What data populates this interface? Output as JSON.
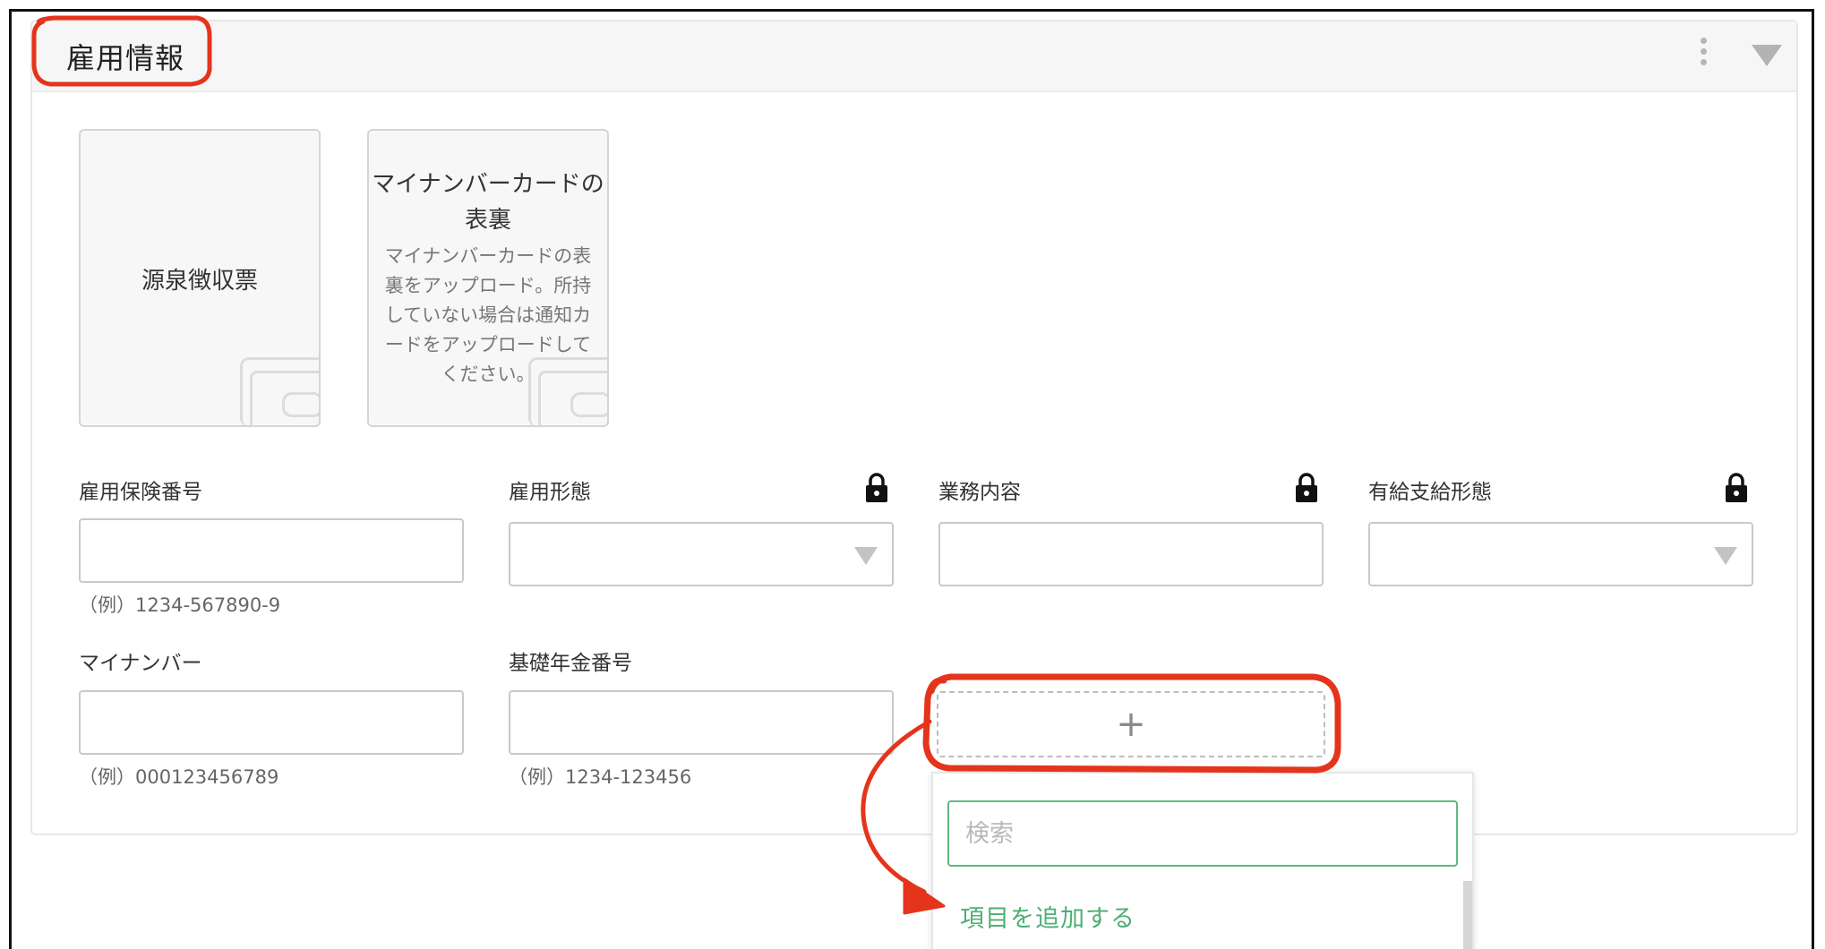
{
  "section": {
    "title": "雇用情報"
  },
  "documents": [
    {
      "title": "源泉徴収票",
      "description": ""
    },
    {
      "title_line1": "マイナンバーカードの",
      "title_line2": "表裏",
      "description_lines": [
        "マイナンバーカードの表",
        "裏をアップロード。所持",
        "していない場合は通知カ",
        "ードをアップロードして",
        "ください。"
      ]
    }
  ],
  "fields": {
    "employment_insurance_no": {
      "label": "雇用保険番号",
      "value": "",
      "hint": "（例）1234-567890-9"
    },
    "employment_type": {
      "label": "雇用形態",
      "value": "",
      "locked": true
    },
    "job_description": {
      "label": "業務内容",
      "value": "",
      "locked": true
    },
    "paid_leave_type": {
      "label": "有給支給形態",
      "value": "",
      "locked": true
    },
    "my_number": {
      "label": "マイナンバー",
      "value": "",
      "hint": "（例）000123456789"
    },
    "pension_no": {
      "label": "基礎年金番号",
      "value": "",
      "hint": "（例）1234-123456"
    }
  },
  "add_field": {
    "plus": "+"
  },
  "dropdown": {
    "search_placeholder": "検索",
    "add_item_label": "項目を追加する"
  },
  "icons": {
    "menu": "kebab-menu-icon",
    "collapse": "triangle-down-icon",
    "lock": "lock-icon",
    "document": "wallet-icon"
  },
  "colors": {
    "annotation": "#e5341c",
    "accent_green": "#4caf74",
    "focus_border": "#5cbb7f"
  }
}
